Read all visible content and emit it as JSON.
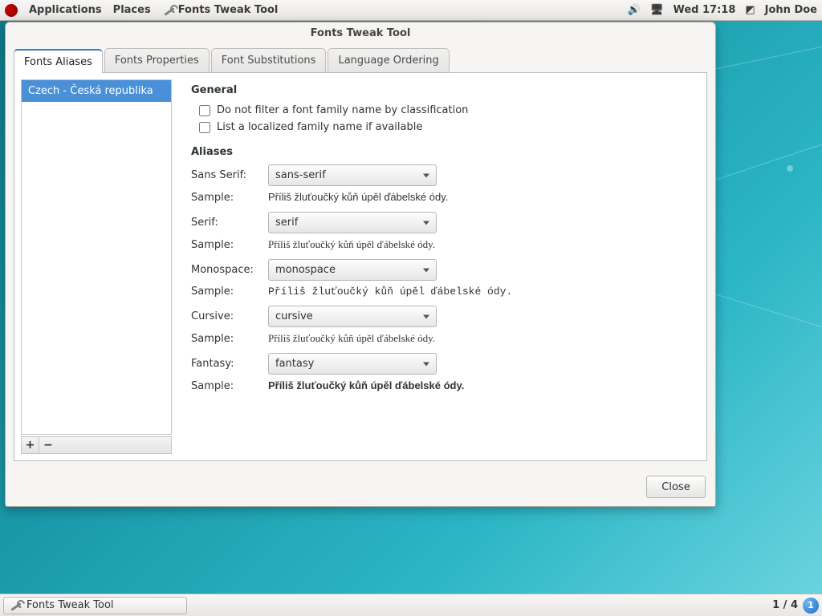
{
  "topbar": {
    "applications": "Applications",
    "places": "Places",
    "app_title": "Fonts Tweak Tool",
    "clock": "Wed 17:18",
    "user": "John Doe"
  },
  "window": {
    "title": "Fonts Tweak Tool",
    "close": "Close"
  },
  "tabs": {
    "aliases": "Fonts Aliases",
    "properties": "Fonts Properties",
    "substitutions": "Font Substitutions",
    "ordering": "Language Ordering"
  },
  "langlist": {
    "item0": "Czech - Česká republika",
    "add": "+",
    "remove": "−"
  },
  "general": {
    "heading": "General",
    "chk_nofilter": "Do not filter a font family name by classification",
    "chk_localized": "List a localized family name if available"
  },
  "aliases": {
    "heading": "Aliases",
    "sample_label": "Sample:",
    "sample_text": "Příliš žluťoučký kůň úpěl ďábelské ódy.",
    "rows": {
      "sans": {
        "label": "Sans Serif:",
        "value": "sans-serif"
      },
      "serif": {
        "label": "Serif:",
        "value": "serif"
      },
      "mono": {
        "label": "Monospace:",
        "value": "monospace"
      },
      "cursive": {
        "label": "Cursive:",
        "value": "cursive"
      },
      "fantasy": {
        "label": "Fantasy:",
        "value": "fantasy"
      }
    }
  },
  "taskbar": {
    "app": "Fonts Tweak Tool",
    "workspace": "1 / 4",
    "badge": "1"
  }
}
